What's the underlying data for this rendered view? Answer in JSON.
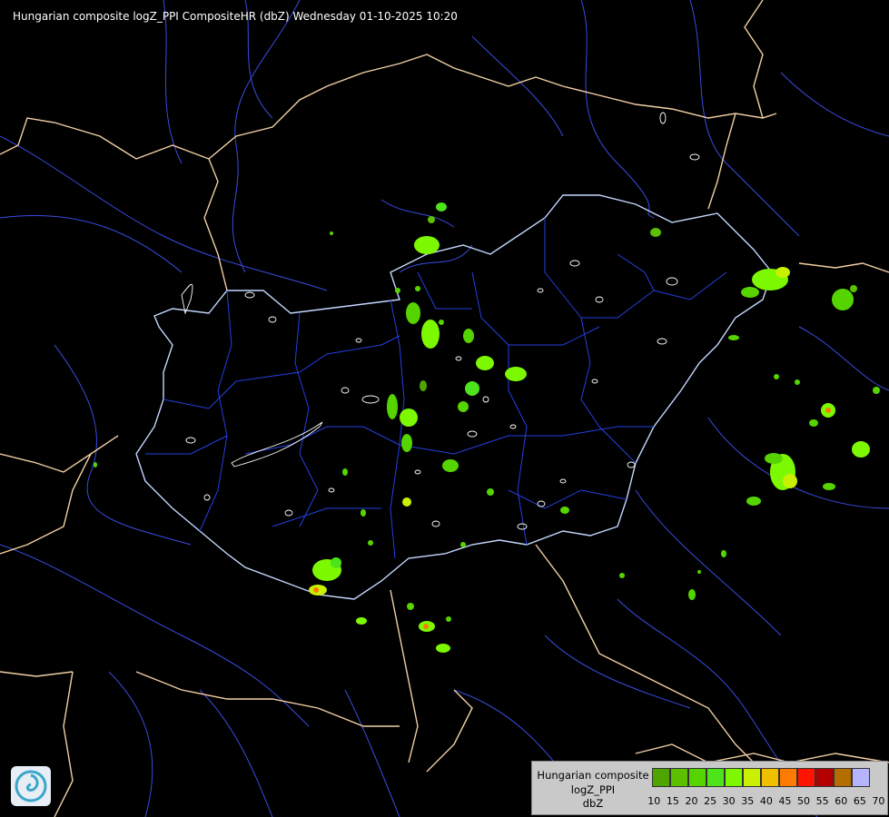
{
  "title": "Hungarian composite logZ_PPI CompositeHR (dbZ) Wednesday 01-10-2025 10:20",
  "legend": {
    "line1": "Hungarian composite",
    "line2": "logZ_PPI",
    "line3": "dbZ",
    "scale": [
      {
        "label": "10",
        "color": "#4fa500"
      },
      {
        "label": "15",
        "color": "#5cc000"
      },
      {
        "label": "20",
        "color": "#55d400"
      },
      {
        "label": "25",
        "color": "#4ee41c"
      },
      {
        "label": "30",
        "color": "#7cf800"
      },
      {
        "label": "35",
        "color": "#c8f000"
      },
      {
        "label": "40",
        "color": "#f0c000"
      },
      {
        "label": "45",
        "color": "#ff7a00"
      },
      {
        "label": "50",
        "color": "#ff1400"
      },
      {
        "label": "55",
        "color": "#b40000"
      },
      {
        "label": "60",
        "color": "#b46e00"
      },
      {
        "label": "65",
        "color": "#a000ff"
      },
      {
        "label": "70",
        "color": "#b4b4ff"
      }
    ]
  },
  "colors": {
    "background": "#000000",
    "country_border": "#f5d2a8",
    "hungary_border": "#b8d0ff",
    "rivers": "#2c44ff",
    "county_lines": "#1f3fd8",
    "lakes": "#ffffff"
  },
  "logo": "met-service-logo-icon"
}
